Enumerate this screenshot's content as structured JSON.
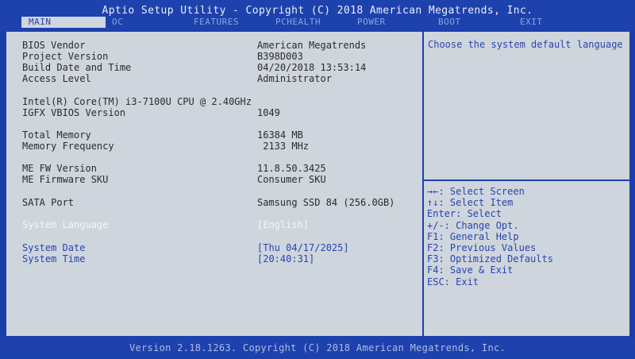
{
  "header": {
    "title": "Aptio Setup Utility - Copyright (C) 2018 American Megatrends, Inc."
  },
  "tabs": [
    "MAIN",
    "OC",
    "FEATURES",
    "PCHEALTH",
    "POWER",
    "BOOT",
    "EXIT"
  ],
  "info": {
    "bios_vendor": {
      "label": "BIOS Vendor",
      "value": "American Megatrends"
    },
    "project_version": {
      "label": "Project Version",
      "value": "B398D003"
    },
    "build_date": {
      "label": "Build Date and Time",
      "value": "04/20/2018 13:53:14"
    },
    "access_level": {
      "label": "Access Level",
      "value": "Administrator"
    },
    "cpu": {
      "label": "Intel(R) Core(TM) i3-7100U CPU @ 2.40GHz",
      "value": ""
    },
    "igfx": {
      "label": "IGFX VBIOS Version",
      "value": "1049"
    },
    "total_memory": {
      "label": "Total Memory",
      "value": "16384 MB"
    },
    "memory_frequency": {
      "label": "Memory Frequency",
      "value": " 2133 MHz"
    },
    "me_fw": {
      "label": "ME FW Version",
      "value": "11.8.50.3425"
    },
    "me_sku": {
      "label": "ME Firmware SKU",
      "value": "Consumer SKU"
    },
    "sata": {
      "label": "SATA Port",
      "value": "Samsung SSD 84 (256.0GB)"
    },
    "language": {
      "label": "System Language",
      "value": "[English]"
    },
    "date": {
      "label": "System Date",
      "value": "[Thu 04/17/2025]"
    },
    "time": {
      "label": "System Time",
      "value": "[20:40:31]"
    }
  },
  "help": {
    "text": "Choose the system default language"
  },
  "keys": [
    "→←: Select Screen",
    "↑↓: Select Item",
    "Enter: Select",
    "+/-: Change Opt.",
    "F1: General Help",
    "F2: Previous Values",
    "F3: Optimized Defaults",
    "F4: Save & Exit",
    "ESC: Exit"
  ],
  "footer": {
    "text": "Version 2.18.1263. Copyright (C) 2018 American Megatrends, Inc."
  }
}
